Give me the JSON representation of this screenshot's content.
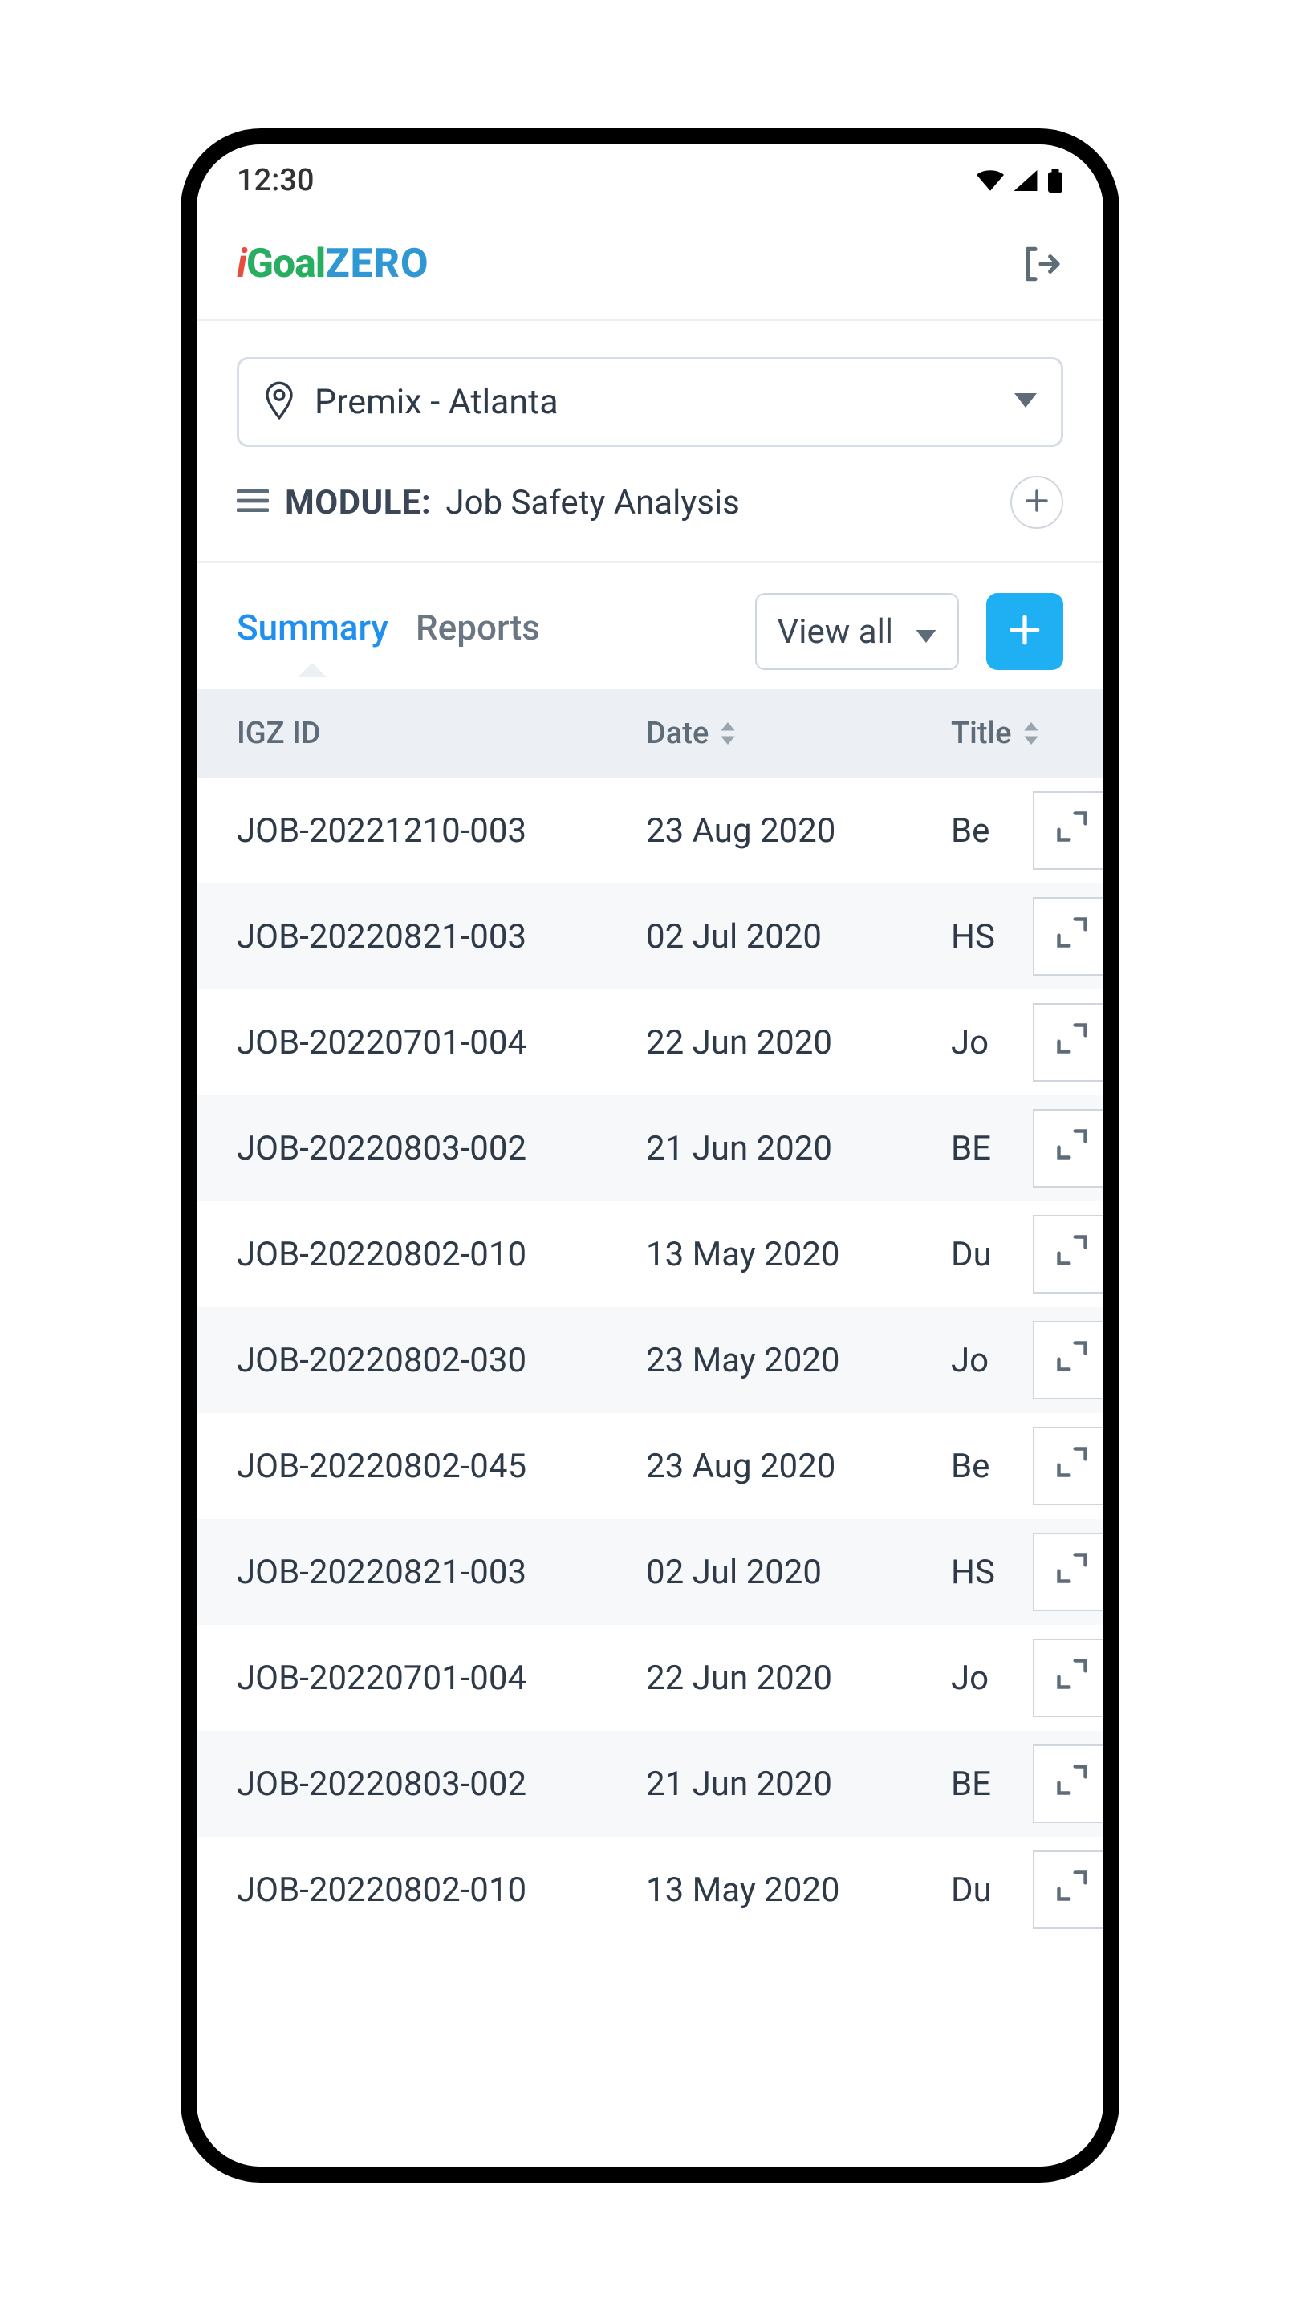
{
  "status": {
    "time": "12:30"
  },
  "app": {
    "logo": {
      "i": "i",
      "goal": "Goal",
      "zero": "ZERO"
    }
  },
  "location": {
    "selected": "Premix - Atlanta"
  },
  "module": {
    "prefix": "MODULE:",
    "name": "Job Safety Analysis"
  },
  "tabs": {
    "summary": "Summary",
    "reports": "Reports"
  },
  "filter": {
    "viewall": "View all"
  },
  "table": {
    "headers": {
      "id": "IGZ ID",
      "date": "Date",
      "title": "Title"
    },
    "rows": [
      {
        "id": "JOB-20221210-003",
        "date": "23 Aug 2020",
        "title": "Be"
      },
      {
        "id": "JOB-20220821-003",
        "date": "02 Jul 2020",
        "title": "HS"
      },
      {
        "id": "JOB-20220701-004",
        "date": "22 Jun 2020",
        "title": "Jo"
      },
      {
        "id": "JOB-20220803-002",
        "date": "21 Jun 2020",
        "title": "BE"
      },
      {
        "id": "JOB-20220802-010",
        "date": "13 May 2020",
        "title": "Du"
      },
      {
        "id": "JOB-20220802-030",
        "date": "23 May 2020",
        "title": "Jo"
      },
      {
        "id": "JOB-20220802-045",
        "date": "23 Aug 2020",
        "title": "Be"
      },
      {
        "id": "JOB-20220821-003",
        "date": "02 Jul 2020",
        "title": "HS"
      },
      {
        "id": "JOB-20220701-004",
        "date": "22 Jun 2020",
        "title": "Jo"
      },
      {
        "id": "JOB-20220803-002",
        "date": "21 Jun 2020",
        "title": "BE"
      },
      {
        "id": "JOB-20220802-010",
        "date": "13 May 2020",
        "title": "Du"
      }
    ]
  }
}
